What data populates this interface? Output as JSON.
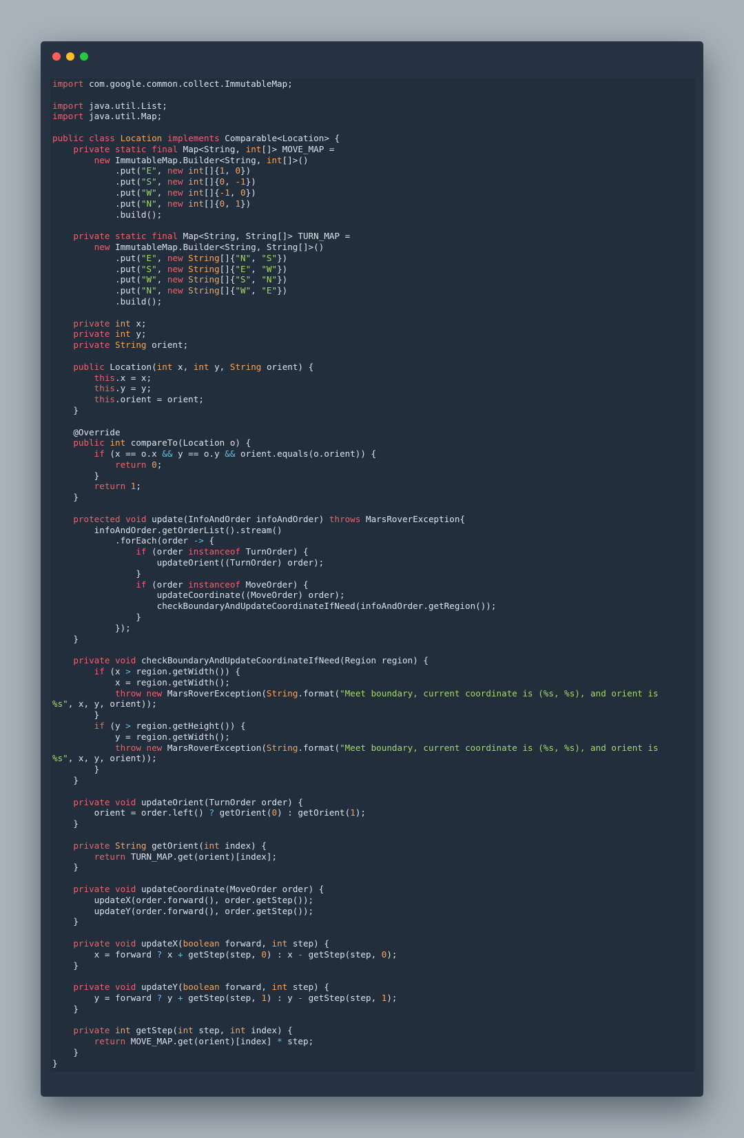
{
  "window": {
    "controls": [
      "close",
      "minimize",
      "maximize"
    ],
    "colors": {
      "close": "#ff5f56",
      "minimize": "#ffbd2e",
      "maximize": "#27c93f"
    }
  },
  "code": {
    "language": "java",
    "lines": [
      "[[k:import]] com.google.common.collect.ImmutableMap;",
      "",
      "[[k:import]] java.util.List;",
      "[[k:import]] java.util.Map;",
      "",
      "[[k:public]] [[k:class]] [[t:Location]] [[k:implements]] Comparable<Location> {",
      "    [[k:private]] [[k:static]] [[k:final]] Map<String, [[t:int]][]> MOVE_MAP =",
      "        [[k:new]] ImmutableMap.Builder<String, [[t:int]][]>()",
      "            .put([[s:\"E\"]], [[k:new]] [[t:int]][]{[[n:1]], [[n:0]]})",
      "            .put([[s:\"S\"]], [[k:new]] [[t:int]][]{[[n:0]], [[n:-1]]})",
      "            .put([[s:\"W\"]], [[k:new]] [[t:int]][]{[[n:-1]], [[n:0]]})",
      "            .put([[s:\"N\"]], [[k:new]] [[t:int]][]{[[n:0]], [[n:1]]})",
      "            .build();",
      "",
      "    [[k:private]] [[k:static]] [[k:final]] Map<String, String[]> TURN_MAP =",
      "        [[k:new]] ImmutableMap.Builder<String, String[]>()",
      "            .put([[s:\"E\"]], [[k:new]] [[t:String]][]{[[s:\"N\"]], [[s:\"S\"]]})",
      "            .put([[s:\"S\"]], [[k:new]] [[t:String]][]{[[s:\"E\"]], [[s:\"W\"]]})",
      "            .put([[s:\"W\"]], [[k:new]] [[t:String]][]{[[s:\"S\"]], [[s:\"N\"]]})",
      "            .put([[s:\"N\"]], [[k:new]] [[t:String]][]{[[s:\"W\"]], [[s:\"E\"]]})",
      "            .build();",
      "",
      "    [[k:private]] [[t:int]] x;",
      "    [[k:private]] [[t:int]] y;",
      "    [[k:private]] [[t:String]] orient;",
      "",
      "    [[k:public]] Location([[t:int]] x, [[t:int]] y, [[t:String]] orient) {",
      "        [[k:this]].x = x;",
      "        [[k:this]].y = y;",
      "        [[k:this]].orient = orient;",
      "    }",
      "",
      "    @Override",
      "    [[k:public]] [[t:int]] compareTo(Location o) {",
      "        [[k:if]] (x == o.x [[o:&&]] y == o.y [[o:&&]] orient.equals(o.orient)) {",
      "            [[k:return]] [[n:0]];",
      "        }",
      "        [[k:return]] [[n:1]];",
      "    }",
      "",
      "    [[k:protected]] [[k:void]] update(InfoAndOrder infoAndOrder) [[k:throws]] MarsRoverException{",
      "        infoAndOrder.getOrderList().stream()",
      "            .forEach(order [[o:->]] {",
      "                [[k:if]] (order [[k:instanceof]] TurnOrder) {",
      "                    updateOrient((TurnOrder) order);",
      "                }",
      "                [[k:if]] (order [[k:instanceof]] MoveOrder) {",
      "                    updateCoordinate((MoveOrder) order);",
      "                    checkBoundaryAndUpdateCoordinateIfNeed(infoAndOrder.getRegion());",
      "                }",
      "            });",
      "    }",
      "",
      "    [[k:private]] [[k:void]] checkBoundaryAndUpdateCoordinateIfNeed(Region region) {",
      "        [[k:if]] (x [[o:>]] region.getWidth()) {",
      "            x = region.getWidth();",
      "            [[k:throw]] [[k:new]] MarsRoverException([[t:String]].format([[s:\"Meet boundary, current coordinate is (%s, %s), and orient is]]",
      "[[s:%s\"]], x, y, orient));",
      "        }",
      "        [[k:if]] (y [[o:>]] region.getHeight()) {",
      "            y = region.getWidth();",
      "            [[k:throw]] [[k:new]] MarsRoverException([[t:String]].format([[s:\"Meet boundary, current coordinate is (%s, %s), and orient is]]",
      "[[s:%s\"]], x, y, orient));",
      "        }",
      "    }",
      "",
      "    [[k:private]] [[k:void]] updateOrient(TurnOrder order) {",
      "        orient = order.left() [[o:?]] getOrient([[n:0]]) : getOrient([[n:1]]);",
      "    }",
      "",
      "    [[k:private]] [[t:String]] getOrient([[t:int]] index) {",
      "        [[k:return]] TURN_MAP.get(orient)[index];",
      "    }",
      "",
      "    [[k:private]] [[k:void]] updateCoordinate(MoveOrder order) {",
      "        updateX(order.forward(), order.getStep());",
      "        updateY(order.forward(), order.getStep());",
      "    }",
      "",
      "    [[k:private]] [[k:void]] updateX([[t:boolean]] forward, [[t:int]] step) {",
      "        x = forward [[o:?]] x [[o:+]] getStep(step, [[n:0]]) : x [[o:-]] getStep(step, [[n:0]]);",
      "    }",
      "",
      "    [[k:private]] [[k:void]] updateY([[t:boolean]] forward, [[t:int]] step) {",
      "        y = forward [[o:?]] y [[o:+]] getStep(step, [[n:1]]) : y [[o:-]] getStep(step, [[n:1]]);",
      "    }",
      "",
      "    [[k:private]] [[t:int]] getStep([[t:int]] step, [[t:int]] index) {",
      "        [[k:return]] MOVE_MAP.get(orient)[index] [[o:*]] step;",
      "    }",
      "}"
    ]
  }
}
